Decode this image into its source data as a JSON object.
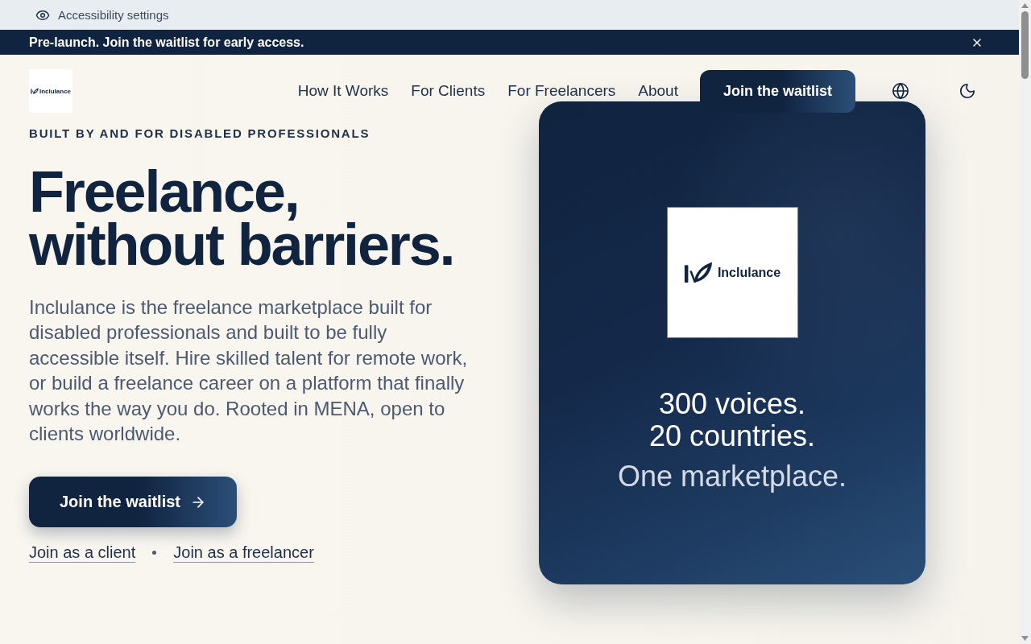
{
  "accessibility_bar": {
    "label": "Accessibility settings"
  },
  "announcement": {
    "text": "Pre-launch. Join the waitlist for early access."
  },
  "header": {
    "logo": {
      "wordmark": "Inclulance"
    },
    "nav": [
      {
        "label": "How It Works"
      },
      {
        "label": "For Clients"
      },
      {
        "label": "For Freelancers"
      },
      {
        "label": "About"
      }
    ],
    "cta": "Join the waitlist"
  },
  "hero": {
    "eyebrow": "BUILT BY AND FOR DISABLED PROFESSIONALS",
    "headline": [
      "Freelance,",
      "without barriers."
    ],
    "description": "Inclulance is the freelance marketplace built for disabled professionals and built to be fully accessible itself. Hire skilled talent for remote work, or build a freelance career on a platform that finally works the way you do. Rooted in MENA, open to clients worldwide.",
    "primary_cta": "Join the waitlist",
    "links": [
      "Join as a client",
      "Join as a freelancer"
    ]
  },
  "card": {
    "logo": {
      "wordmark": "Inclulance"
    },
    "stats": [
      "300 voices.",
      "20 countries."
    ],
    "tagline": "One marketplace."
  }
}
